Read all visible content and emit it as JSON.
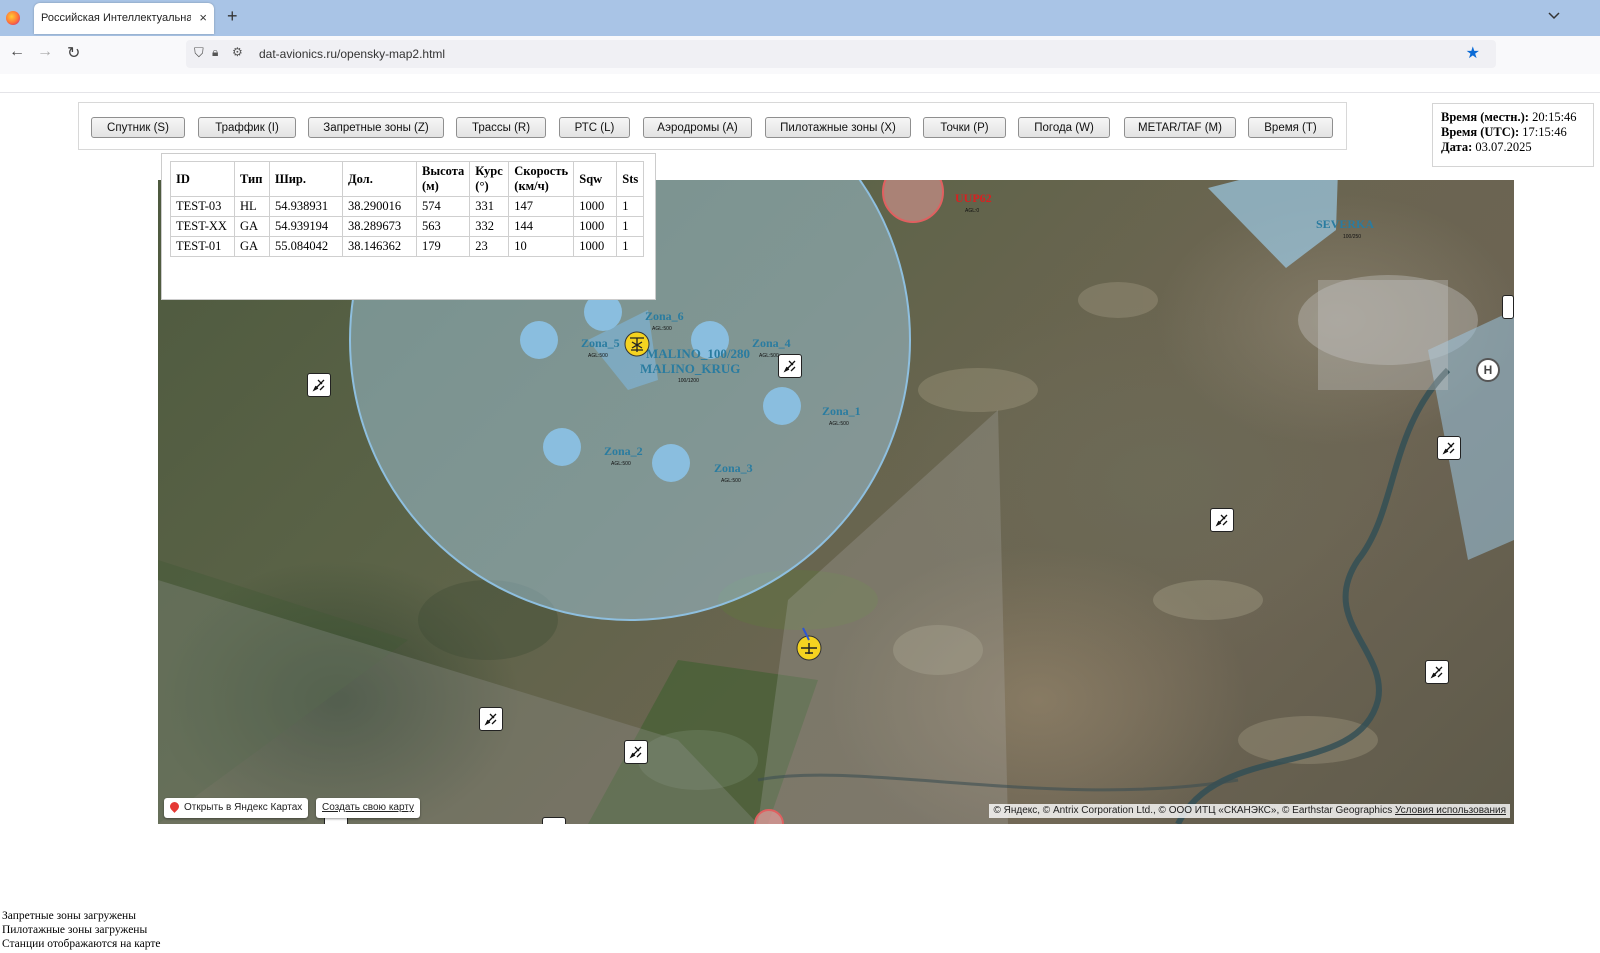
{
  "browser": {
    "tab_title": "Российская Интеллектуальная Си",
    "tab_close": "×",
    "new_tab": "+",
    "url": "dat-avionics.ru/opensky-map2.html"
  },
  "toolbar": {
    "buttons": [
      "Спутник (S)",
      "Траффик (I)",
      "Запретные зоны (Z)",
      "Трассы (R)",
      "РТС (L)",
      "Аэродромы (A)",
      "Пилотажные зоны (X)",
      "Точки (P)",
      "Погода (W)",
      "METAR/TAF (M)",
      "Время (T)"
    ]
  },
  "time": {
    "local_label": "Время (местн.):",
    "local_value": "20:15:46",
    "utc_label": "Время (UTC):",
    "utc_value": "17:15:46",
    "date_label": "Дата:",
    "date_value": "03.07.2025"
  },
  "traffic": {
    "headers": [
      "ID",
      "Тип",
      "Шир.",
      "Дол.",
      "Высота (м)",
      "Курс (°)",
      "Скорость (км/ч)",
      "Sqw",
      "Sts"
    ],
    "rows": [
      [
        "TEST-03",
        "HL",
        "54.938931",
        "38.290016",
        "574",
        "331",
        "147",
        "1000",
        "1"
      ],
      [
        "TEST-XX",
        "GA",
        "54.939194",
        "38.289673",
        "563",
        "332",
        "144",
        "1000",
        "1"
      ],
      [
        "TEST-01",
        "GA",
        "55.084042",
        "38.146362",
        "179",
        "23",
        "10",
        "1000",
        "1"
      ]
    ]
  },
  "map": {
    "zones": [
      {
        "name": "Zona_6",
        "sub": "AGL:500"
      },
      {
        "name": "Zona_5",
        "sub": "AGL:500"
      },
      {
        "name": "Zona_4",
        "sub": "AGL:500"
      },
      {
        "name": "Zona_1",
        "sub": "AGL:500"
      },
      {
        "name": "Zona_2",
        "sub": "AGL:500"
      },
      {
        "name": "Zona_3",
        "sub": "AGL:500"
      }
    ],
    "malino_label": "MALINO_100/280",
    "malino_krug": "MALINO_KRUG",
    "malino_sub": "100/1200",
    "restricted_label": "UUP62",
    "restricted_sub": "AGL:0",
    "severka_label": "SEVERKA",
    "severka_sub": "100/250",
    "heli_letter": "H",
    "yandex_open": "Открыть в Яндекс Картах",
    "yandex_create": "Создать свою карту",
    "copyright": "© Яндекс, © Antrix Corporation Ltd., © ООО ИТЦ «СКАНЭКС», © Earthstar Geographics",
    "terms": "Условия использования"
  },
  "status": [
    "Запретные зоны загружены",
    "Пилотажные зоны загружены",
    "Станции отображаются на карте"
  ]
}
